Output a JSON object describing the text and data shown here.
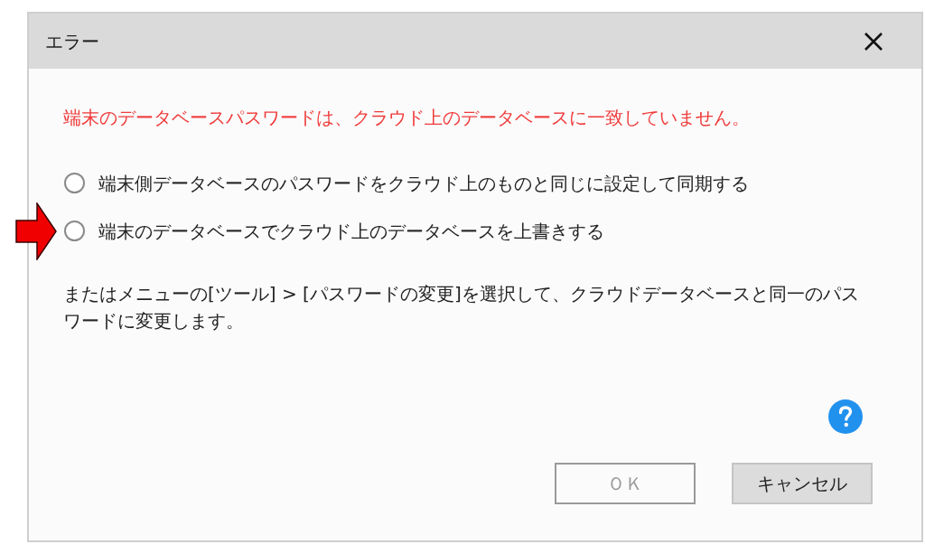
{
  "window": {
    "title": "エラー"
  },
  "message": "端末のデータベースパスワードは、クラウド上のデータベースに一致していません。",
  "options": [
    {
      "label": "端末側データベースのパスワードをクラウド上のものと同じに設定して同期する",
      "selected": false,
      "marked_by_arrow": false
    },
    {
      "label": "端末のデータベースでクラウド上のデータベースを上書きする",
      "selected": false,
      "marked_by_arrow": true
    }
  ],
  "note": "またはメニューの[ツール] > [パスワードの変更]を選択して、クラウドデータベースと同一のパスワードに変更します。",
  "buttons": [
    {
      "label": "ＯＫ",
      "kind": "default",
      "disabled": true
    },
    {
      "label": "キャンセル",
      "kind": "cancel",
      "disabled": false
    }
  ]
}
